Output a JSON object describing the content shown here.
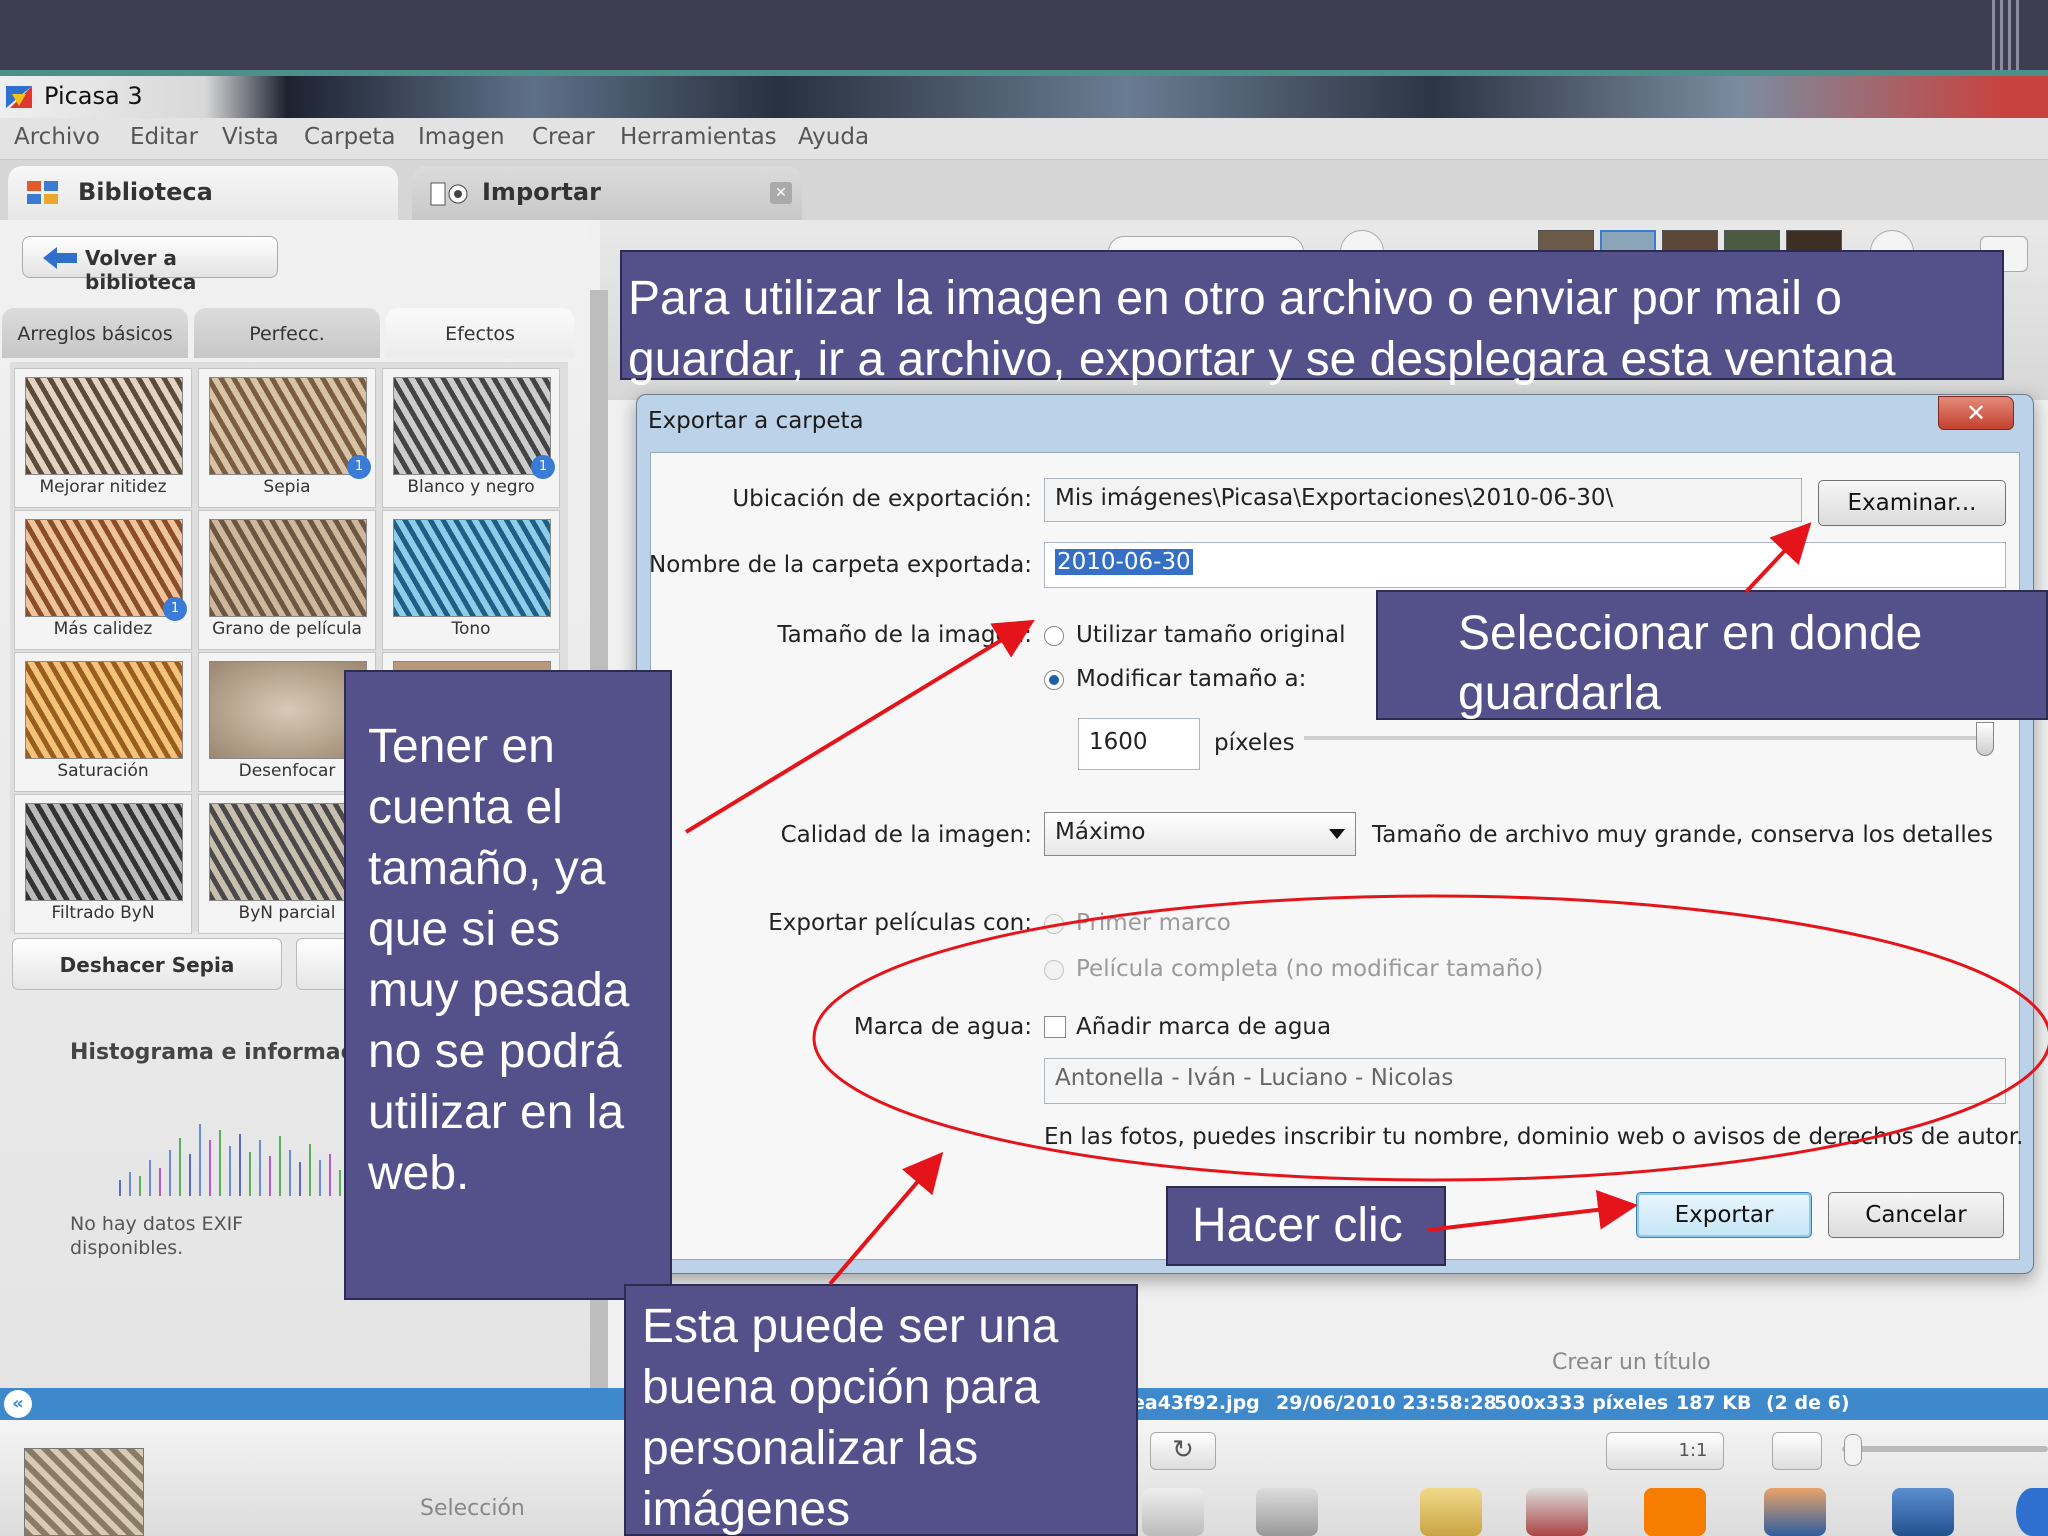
{
  "window": {
    "title": "Picasa 3"
  },
  "menu": [
    "Archivo",
    "Editar",
    "Vista",
    "Carpeta",
    "Imagen",
    "Crear",
    "Herramientas",
    "Ayuda"
  ],
  "tabs": {
    "biblioteca": "Biblioteca",
    "importar": "Importar",
    "close_glyph": "✕"
  },
  "left": {
    "back_label": "Volver a biblioteca",
    "panel_tabs": [
      "Arreglos básicos",
      "Perfecc.",
      "Efectos"
    ],
    "effects": [
      "Mejorar nitidez",
      "Sepia",
      "Blanco y negro",
      "Más calidez",
      "Grano de película",
      "Tono",
      "Saturación",
      "Desenfocar",
      "",
      "Filtrado ByN",
      "ByN parcial",
      ""
    ],
    "undo_label": "Deshacer Sepia",
    "histogram_title": "Histograma e información",
    "exif_text": "No hay datos EXIF disponibles.",
    "badge_text": "1"
  },
  "status": {
    "collapse_glyph": "«",
    "filename": "ea43f92.jpg",
    "datetime": "29/06/2010 23:58:28",
    "dimensions": "500x333 píxeles",
    "size": "187 KB",
    "position": "(2 de 6)",
    "create_title": "Crear un título"
  },
  "tray": {
    "selection_label": "Selección",
    "rotate_glyph": "↻",
    "zoom_label": "1:1"
  },
  "dialog": {
    "title": "Exportar a carpeta",
    "close_glyph": "✕",
    "location_label": "Ubicación de exportación:",
    "location_value": "Mis imágenes\\Picasa\\Exportaciones\\2010-06-30\\",
    "browse_label": "Examinar...",
    "folder_label": "Nombre de la carpeta exportada:",
    "folder_value": "2010-06-30",
    "size_label": "Tamaño de la imagen:",
    "size_original": "Utilizar tamaño original",
    "size_modify": "Modificar tamaño a:",
    "size_value": "1600",
    "size_unit": "píxeles",
    "size_slider_level": 1.0,
    "quality_label": "Calidad de la imagen:",
    "quality_value": "Máximo",
    "quality_hint": "Tamaño de archivo muy grande, conserva los detalles",
    "movies_label": "Exportar películas con:",
    "movies_first": "Primer marco",
    "movies_full": "Película completa (no modificar tamaño)",
    "watermark_label": "Marca de agua:",
    "watermark_check": "Añadir marca de agua",
    "watermark_value": "Antonella - Iván - Luciano - Nicolas",
    "watermark_hint": "En las fotos, puedes inscribir tu nombre, dominio web o avisos de derechos de autor.",
    "export_label": "Exportar",
    "cancel_label": "Cancelar"
  },
  "callouts": {
    "top": "Para utilizar la imagen en otro archivo o enviar por mail o guardar,  ir a archivo, exportar y se desplegara esta ventana",
    "location": "Seleccionar en donde guardarla",
    "size_lines": [
      "Tener en",
      "cuenta el",
      "tamaño, ya",
      "que si es",
      "muy pesada",
      "no se podrá",
      "utilizar en la",
      "web."
    ],
    "click": "Hacer clic",
    "watermark": "Esta puede ser una buena opción para personalizar las imágenes"
  },
  "colors": {
    "callout_bg": "#54508a",
    "annotation_red": "#e5141b",
    "slide_bg": "#3e3d52",
    "slide_rule": "#4d8f8a"
  }
}
